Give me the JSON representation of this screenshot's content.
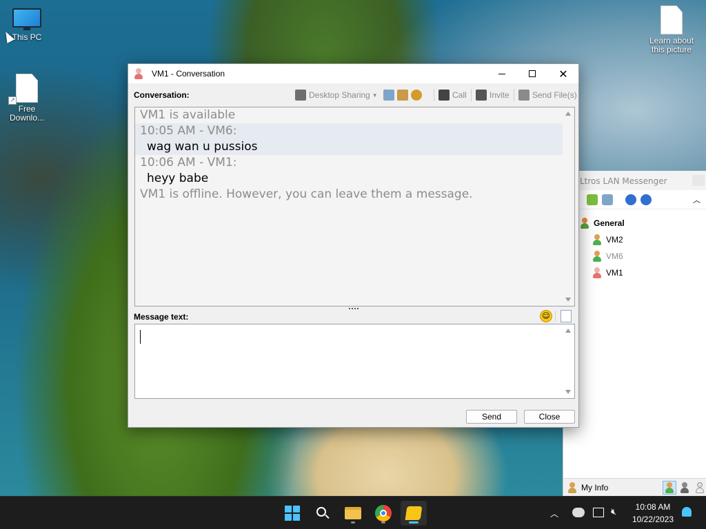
{
  "desktop": {
    "icons": [
      {
        "label": "This PC"
      },
      {
        "label": "Free Downlo..."
      },
      {
        "label": "Learn about this picture"
      }
    ]
  },
  "conversation": {
    "title": "VM1 - Conversation",
    "conversation_label": "Conversation:",
    "toolbar": {
      "desktop_sharing": "Desktop Sharing",
      "call": "Call",
      "invite": "Invite",
      "send_files": "Send File(s)"
    },
    "history": [
      {
        "text": "VM1 is available",
        "style": "status"
      },
      {
        "text": "10:05 AM - VM6:",
        "style": "header",
        "highlight": true
      },
      {
        "text": "wag wan u pussios",
        "style": "message",
        "highlight": true
      },
      {
        "text": "10:06 AM - VM1:",
        "style": "header"
      },
      {
        "text": "heyy babe",
        "style": "message"
      },
      {
        "text": "VM1 is offline. However, you can leave them a message.",
        "style": "status"
      }
    ],
    "message_label": "Message text:",
    "message_value": "",
    "send_label": "Send",
    "close_label": "Close"
  },
  "messenger": {
    "title": "Ltros LAN Messenger",
    "group": "General",
    "users": [
      {
        "name": "VM2",
        "status": "online"
      },
      {
        "name": "VM6",
        "status": "online-dim"
      },
      {
        "name": "VM1",
        "status": "offline"
      }
    ],
    "my_info_label": "My Info"
  },
  "taskbar": {
    "time": "10:08 AM",
    "date": "10/22/2023",
    "apps": [
      "start",
      "search",
      "file-explorer",
      "chrome",
      "lan-messenger"
    ]
  },
  "colors": {
    "accent": "#0078d4",
    "online": "#4caf50",
    "offline": "#e57373",
    "status_text": "#8c8c8c"
  }
}
